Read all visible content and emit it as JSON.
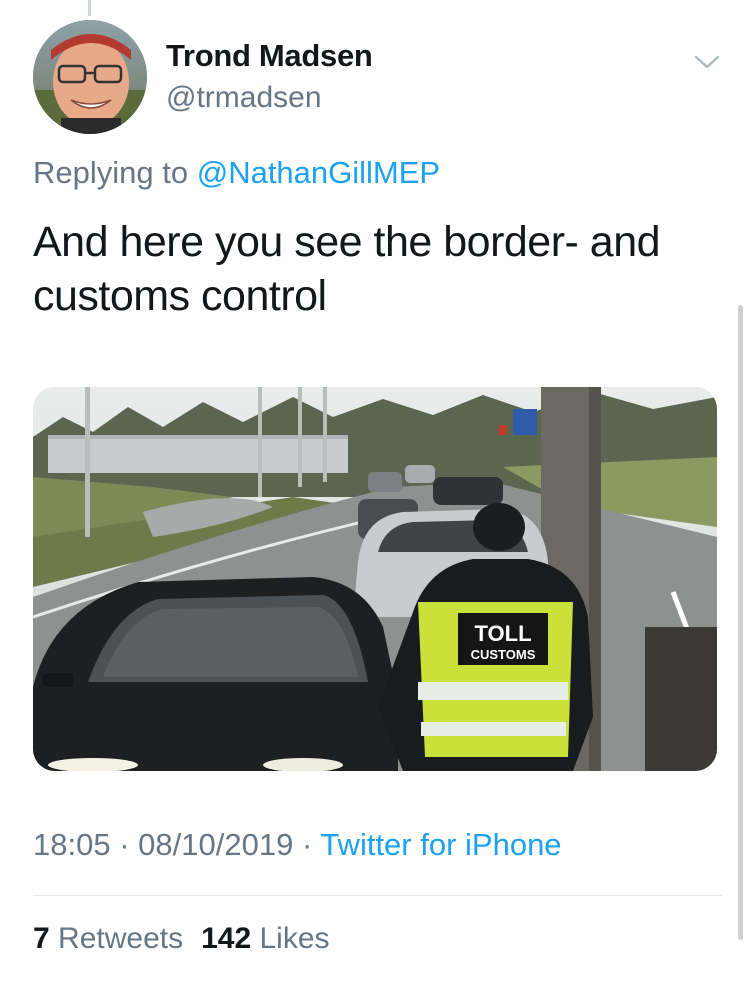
{
  "author": {
    "name": "Trond Madsen",
    "handle": "@trmadsen",
    "avatar_icon": "profile-photo-smiling-man-with-glasses"
  },
  "reply": {
    "prefix": "Replying to",
    "mention": "@NathanGillMEP"
  },
  "tweet": {
    "text": "And here you see the border- and customs control"
  },
  "media": {
    "vest_line1": "TOLL",
    "vest_line2": "CUSTOMS"
  },
  "meta": {
    "time": "18:05",
    "separator": "·",
    "date": "08/10/2019",
    "source": "Twitter for iPhone"
  },
  "stats": {
    "retweets_count": "7",
    "retweets_label": "Retweets",
    "likes_count": "142",
    "likes_label": "Likes"
  },
  "colors": {
    "link": "#1da1f2",
    "secondary_text": "#657786",
    "primary_text": "#14171a",
    "divider": "#e1e8ed"
  }
}
